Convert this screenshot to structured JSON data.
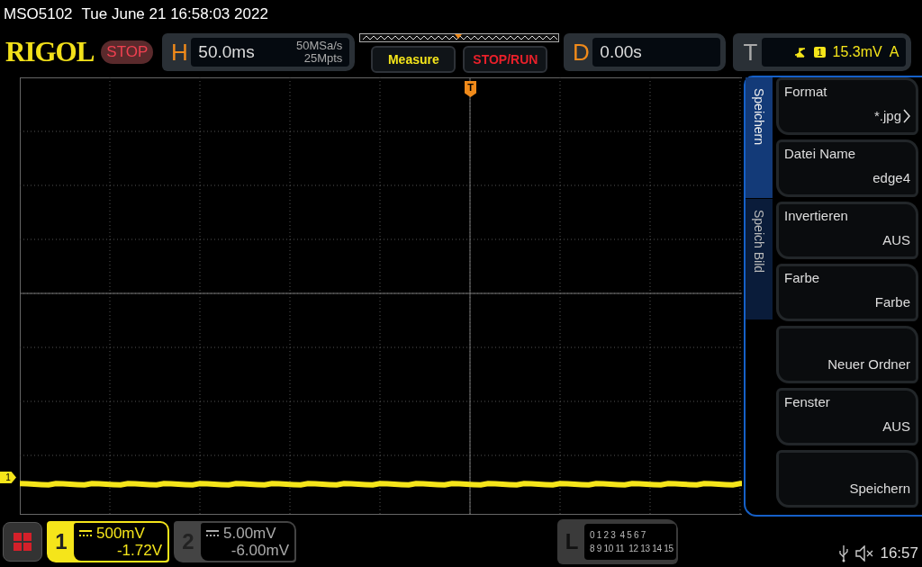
{
  "title_bar": {
    "model": "MSO5102",
    "datetime": "Tue June 21 16:58:03 2022"
  },
  "header": {
    "logo": "RIGOL",
    "run_state": "STOP",
    "horizontal": {
      "label": "H",
      "timebase": "50.0ms",
      "sample_rate": "50MSa/s",
      "memory_depth": "25Mpts"
    },
    "buttons": [
      {
        "label": "Measure",
        "kind": "measure"
      },
      {
        "label": "STOP/RUN",
        "kind": "stoprun"
      }
    ],
    "delay": {
      "label": "D",
      "value": "0.00s"
    },
    "trigger": {
      "label": "T",
      "source": "1",
      "level": "15.3mV",
      "mode": "A"
    }
  },
  "trigger_marker": "T",
  "channel_marker": "1",
  "side_tabs": [
    {
      "label": "Speichern",
      "selected": true
    },
    {
      "label": "Speich Bild",
      "selected": false
    }
  ],
  "menu_items": [
    {
      "label": "Format",
      "value": "*.jpg",
      "has_submenu": true
    },
    {
      "label": "Datei Name",
      "value": "edge4",
      "has_submenu": false
    },
    {
      "label": "Invertieren",
      "value": "AUS",
      "has_submenu": false
    },
    {
      "label": "Farbe",
      "value": "Farbe",
      "has_submenu": false
    },
    {
      "value": "Neuer Ordner",
      "has_submenu": false
    },
    {
      "label": "Fenster",
      "value": "AUS",
      "has_submenu": false
    },
    {
      "value": "Speichern",
      "has_submenu": false
    }
  ],
  "channels": [
    {
      "number": "1",
      "scale": "500mV",
      "offset": "-1.72V",
      "selected": true
    },
    {
      "number": "2",
      "scale": "5.00mV",
      "offset": "-6.00mV",
      "selected": false
    }
  ],
  "logic": {
    "label": "L",
    "rows": [
      [
        "0 1 2 3",
        "4 5 6 7"
      ],
      [
        "8 9 10 11",
        "12 13 14 15"
      ]
    ]
  },
  "status": {
    "time": "16:57"
  }
}
